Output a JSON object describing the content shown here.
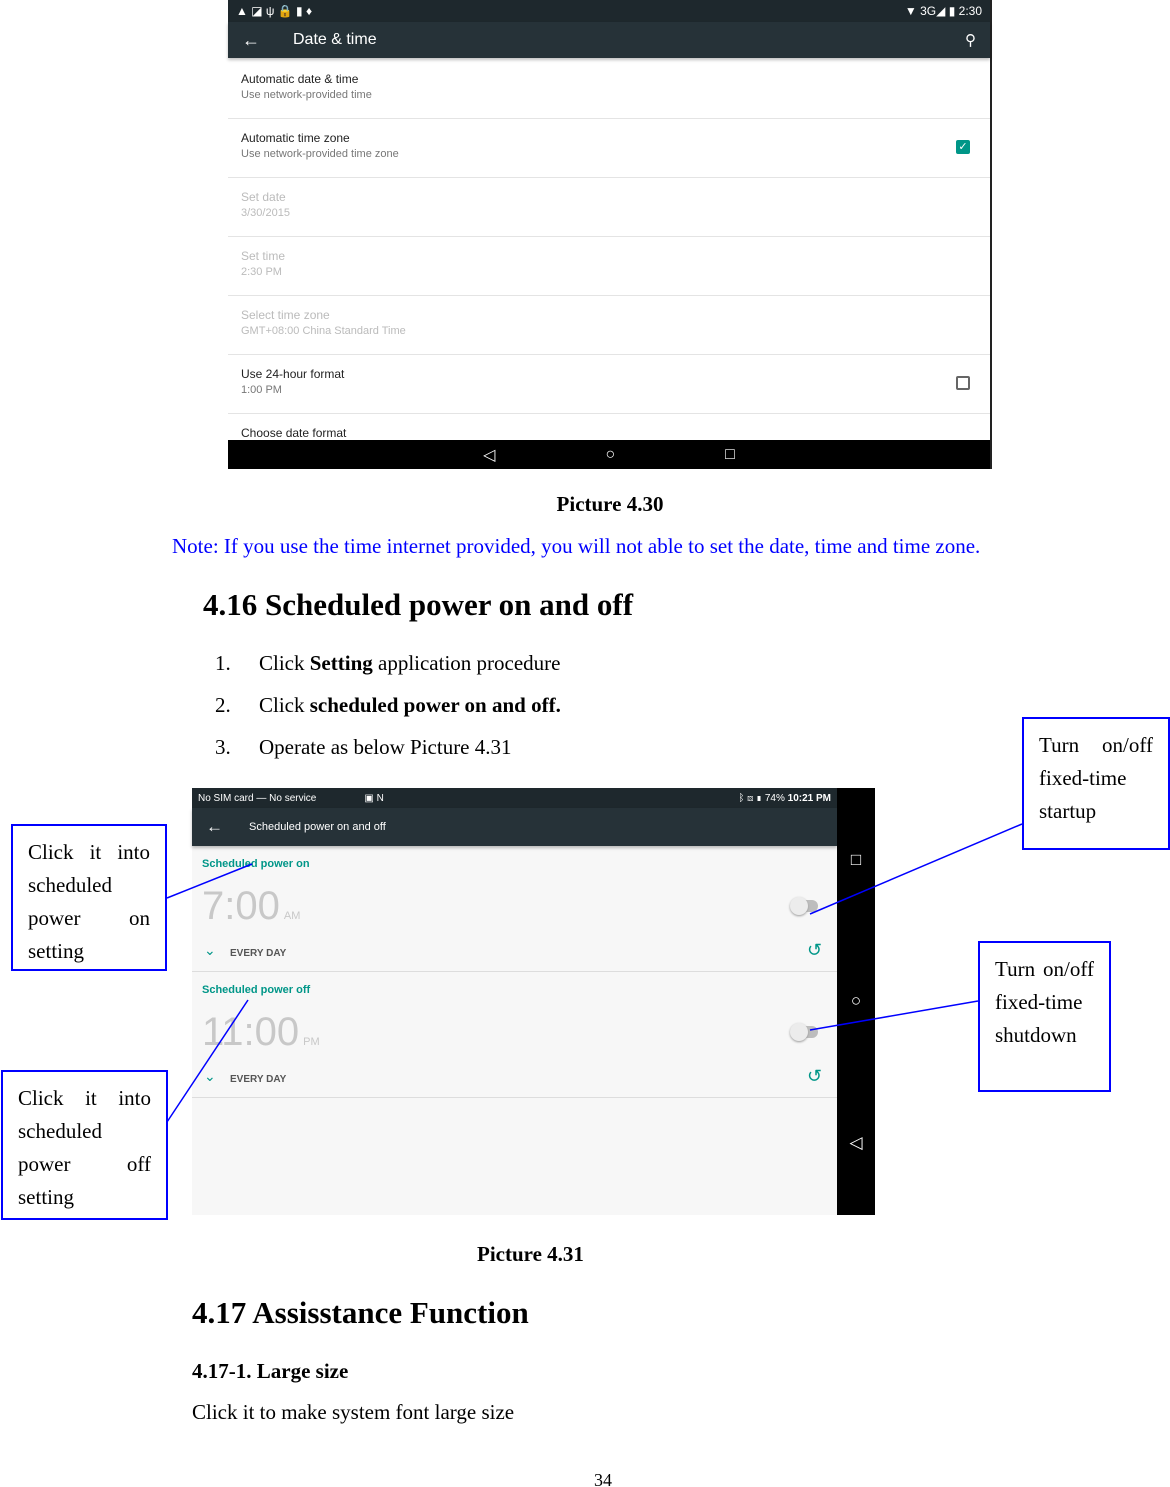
{
  "screen1": {
    "status_icons": [
      "warning-icon",
      "image-icon",
      "usb-icon",
      "lock-icon",
      "sd-icon",
      "pin-icon"
    ],
    "status_right": "3G",
    "clock": "2:30",
    "title": "Date & time",
    "rows": [
      {
        "title": "Automatic date & time",
        "subtitle": "Use network-provided time"
      },
      {
        "title": "Automatic time zone",
        "subtitle": "Use network-provided time zone",
        "checked": true
      },
      {
        "title": "Set date",
        "subtitle": "3/30/2015"
      },
      {
        "title": "Set time",
        "subtitle": "2:30 PM"
      },
      {
        "title": "Select time zone",
        "subtitle": "GMT+08:00 China Standard Time"
      },
      {
        "title": "Use 24-hour format",
        "subtitle": "1:00 PM",
        "checked": false
      },
      {
        "title": "Choose date format"
      }
    ]
  },
  "caption1": "Picture 4.30",
  "note": "Note: If you use the time internet provided, you will not able to set the date, time and time zone.",
  "section416": {
    "heading": "4.16 Scheduled power on and off",
    "steps": [
      {
        "num": "1.",
        "pre": "Click ",
        "bold": "Setting",
        "post": " application procedure"
      },
      {
        "num": "2.",
        "pre": "Click ",
        "bold": "scheduled power on and off.",
        "post": ""
      },
      {
        "num": "3.",
        "pre": "Operate as below Picture 4.31",
        "bold": "",
        "post": ""
      }
    ]
  },
  "screen2": {
    "status_left": "No SIM card — No service",
    "battery": "74%",
    "clock": "10:21 PM",
    "title": "Scheduled power on and off",
    "on": {
      "label": "Scheduled power on",
      "time": "7:00",
      "ampm": "AM",
      "repeat": "EVERY DAY"
    },
    "off": {
      "label": "Scheduled power off",
      "time": "11:00",
      "ampm": "PM",
      "repeat": "EVERY DAY"
    }
  },
  "callouts": {
    "power_on": "Click it into scheduled power on setting",
    "power_off": "Click it into scheduled power off setting",
    "startup": "Turn on/off fixed-time startup",
    "shutdown": "Turn on/off fixed-time shutdown"
  },
  "caption2": "Picture 4.31",
  "section417": {
    "heading": "4.17 Assisstance Function",
    "subheading": "4.17-1. Large size",
    "text": "Click it to make system font large size"
  },
  "page_number": "34",
  "colors": {
    "accent": "#009688",
    "note": "#0000ff",
    "toolbar": "#263238"
  }
}
